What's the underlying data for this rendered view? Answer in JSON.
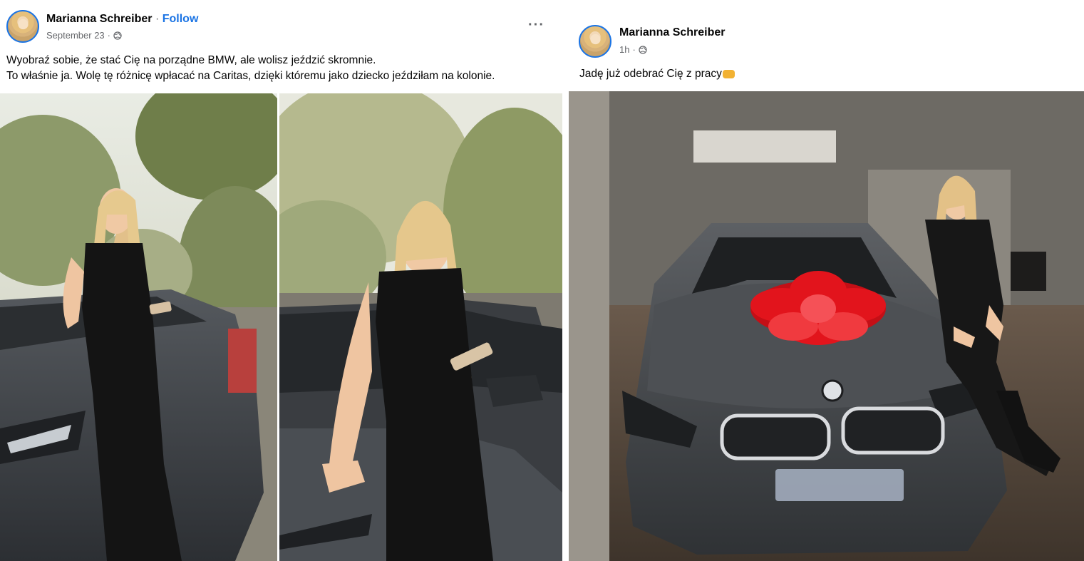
{
  "left_post": {
    "author": "Marianna Schreiber",
    "separator": "·",
    "follow_label": "Follow",
    "timestamp": "September 23",
    "audience_icon": "globe-icon",
    "more_icon": "more-options-icon",
    "more_label": "···",
    "text_line_1": "Wyobraź sobie, że stać Cię na porządne BMW, ale wolisz jeździć skromnie.",
    "text_line_2": "To właśnie ja. Wolę tę różnicę wpłacać na Caritas, dzięki któremu jako dziecko jeździłam na kolonie.",
    "photos": [
      "photo-woman-leaning-on-grey-car-left",
      "photo-woman-leaning-on-grey-car-right"
    ]
  },
  "right_post": {
    "author": "Marianna Schreiber",
    "timestamp": "1h",
    "audience_icon": "globe-icon",
    "caption": "Jadę już odebrać Cię z pracy",
    "caption_emoji": "flexed-biceps-emoji",
    "photo": "photo-woman-sitting-on-grey-bmw-with-red-bow-in-showroom"
  },
  "colors": {
    "link_blue": "#1b74e4",
    "secondary_text": "#65676b",
    "primary_text": "#050505",
    "bow_red": "#e2141c",
    "car_grey": "#46494d"
  }
}
